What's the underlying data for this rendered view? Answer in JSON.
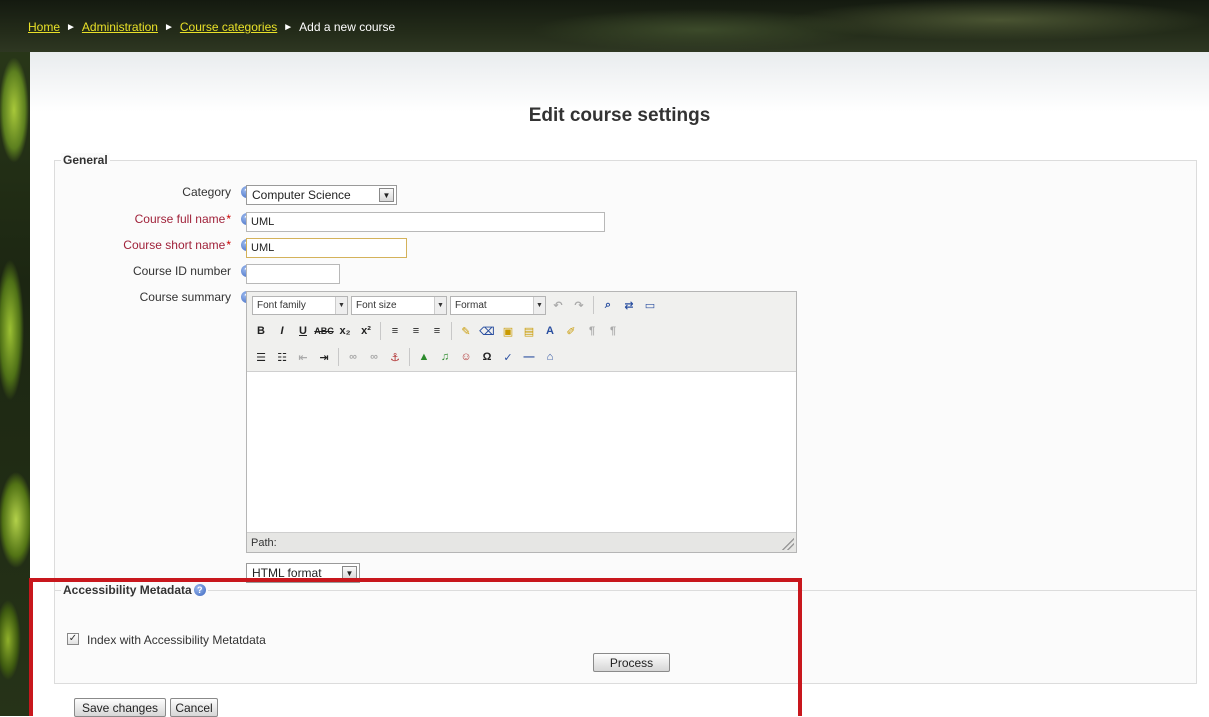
{
  "breadcrumb": {
    "items": [
      "Home",
      "Administration",
      "Course categories"
    ],
    "current": "Add a new course",
    "separator": "►"
  },
  "page": {
    "title": "Edit course settings"
  },
  "general": {
    "legend": "General",
    "category": {
      "label": "Category",
      "value": "Computer Science"
    },
    "full_name": {
      "label": "Course full name",
      "required_mark": "*",
      "value": "UML"
    },
    "short_name": {
      "label": "Course short name",
      "required_mark": "*",
      "value": "UML"
    },
    "id_number": {
      "label": "Course ID number",
      "value": ""
    },
    "summary": {
      "label": "Course summary",
      "font_family": "Font family",
      "font_size": "Font size",
      "format": "Format",
      "path_label": "Path:",
      "format_select": "HTML format"
    }
  },
  "accessibility": {
    "legend": "Accessibility Metadata",
    "checkbox_label": "Index with Accessibility Metatdata",
    "checked": true,
    "process_button": "Process"
  },
  "footer": {
    "save_button": "Save changes",
    "cancel_button": "Cancel"
  },
  "colors": {
    "highlight": "#c8171d",
    "link": "#e8e028",
    "required": "#a0223a"
  }
}
